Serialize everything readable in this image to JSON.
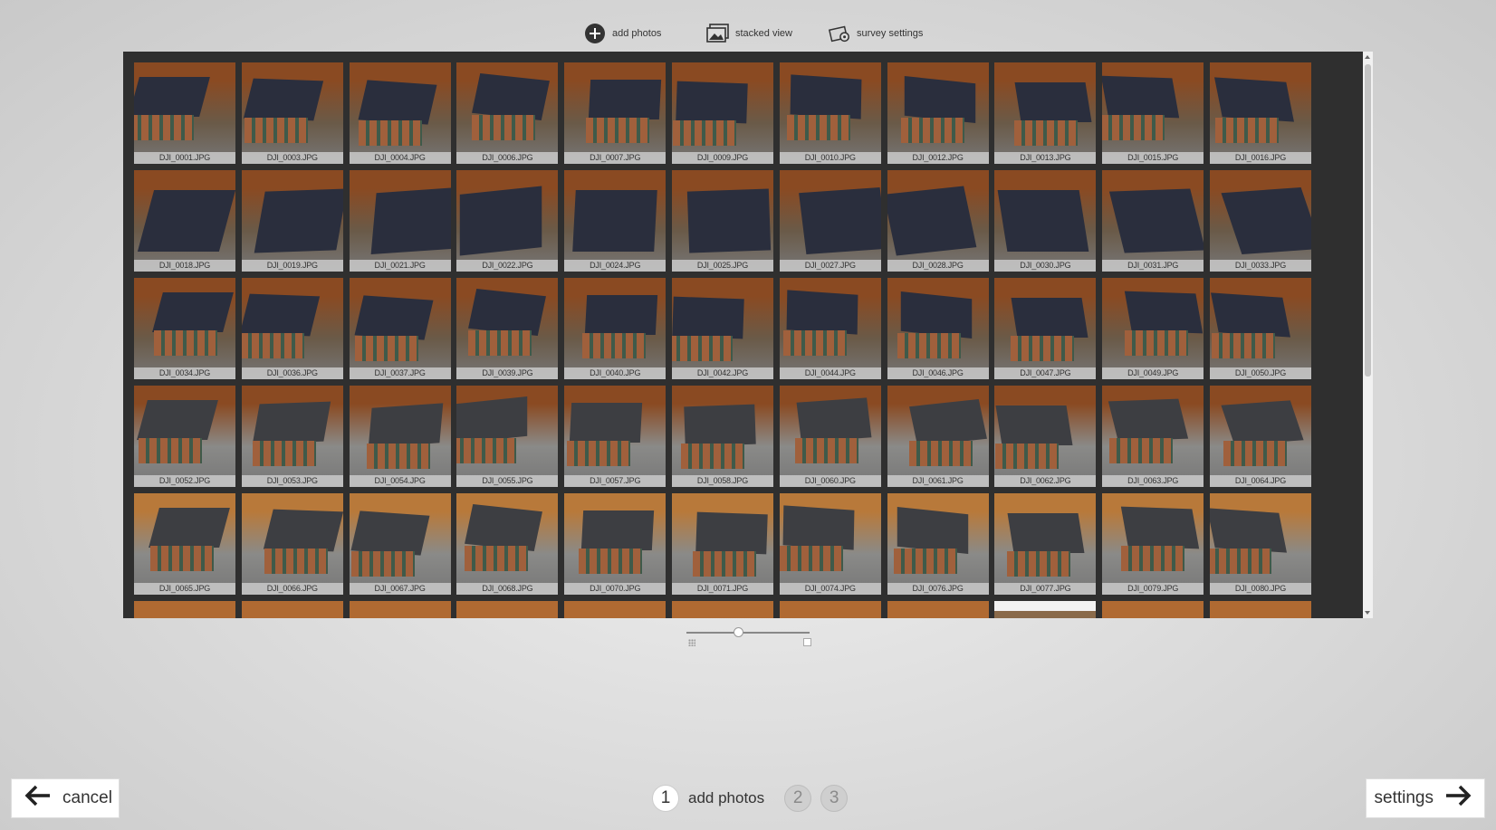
{
  "toolbar": {
    "add_photos": "add photos",
    "stacked_view": "stacked view",
    "survey_settings": "survey settings",
    "icons": [
      "plus-circle-icon",
      "stacked-photos-icon",
      "survey-camera-icon"
    ]
  },
  "gallery": {
    "photos": [
      "DJI_0001.JPG",
      "DJI_0003.JPG",
      "DJI_0004.JPG",
      "DJI_0006.JPG",
      "DJI_0007.JPG",
      "DJI_0009.JPG",
      "DJI_0010.JPG",
      "DJI_0012.JPG",
      "DJI_0013.JPG",
      "DJI_0015.JPG",
      "DJI_0016.JPG",
      "DJI_0018.JPG",
      "DJI_0019.JPG",
      "DJI_0021.JPG",
      "DJI_0022.JPG",
      "DJI_0024.JPG",
      "DJI_0025.JPG",
      "DJI_0027.JPG",
      "DJI_0028.JPG",
      "DJI_0030.JPG",
      "DJI_0031.JPG",
      "DJI_0033.JPG",
      "DJI_0034.JPG",
      "DJI_0036.JPG",
      "DJI_0037.JPG",
      "DJI_0039.JPG",
      "DJI_0040.JPG",
      "DJI_0042.JPG",
      "DJI_0044.JPG",
      "DJI_0046.JPG",
      "DJI_0047.JPG",
      "DJI_0049.JPG",
      "DJI_0050.JPG",
      "DJI_0052.JPG",
      "DJI_0053.JPG",
      "DJI_0054.JPG",
      "DJI_0055.JPG",
      "DJI_0057.JPG",
      "DJI_0058.JPG",
      "DJI_0060.JPG",
      "DJI_0061.JPG",
      "DJI_0062.JPG",
      "DJI_0063.JPG",
      "DJI_0064.JPG",
      "DJI_0065.JPG",
      "DJI_0066.JPG",
      "DJI_0067.JPG",
      "DJI_0068.JPG",
      "DJI_0070.JPG",
      "DJI_0071.JPG",
      "DJI_0074.JPG",
      "DJI_0076.JPG",
      "DJI_0077.JPG",
      "DJI_0079.JPG",
      "DJI_0080.JPG"
    ],
    "partial_row_count": 11
  },
  "zoom_slider": {
    "value_fraction": 0.42
  },
  "footer": {
    "cancel_label": "cancel",
    "next_label": "settings",
    "steps": [
      {
        "number": "1",
        "label": "add photos",
        "active": true
      },
      {
        "number": "2",
        "label": "",
        "active": false
      },
      {
        "number": "3",
        "label": "",
        "active": false
      }
    ]
  },
  "colors": {
    "panel_bg": "#2f2f2f",
    "roof": "#2a2e3d",
    "brick": "#a0603c",
    "foliage": "#8a4a22"
  }
}
